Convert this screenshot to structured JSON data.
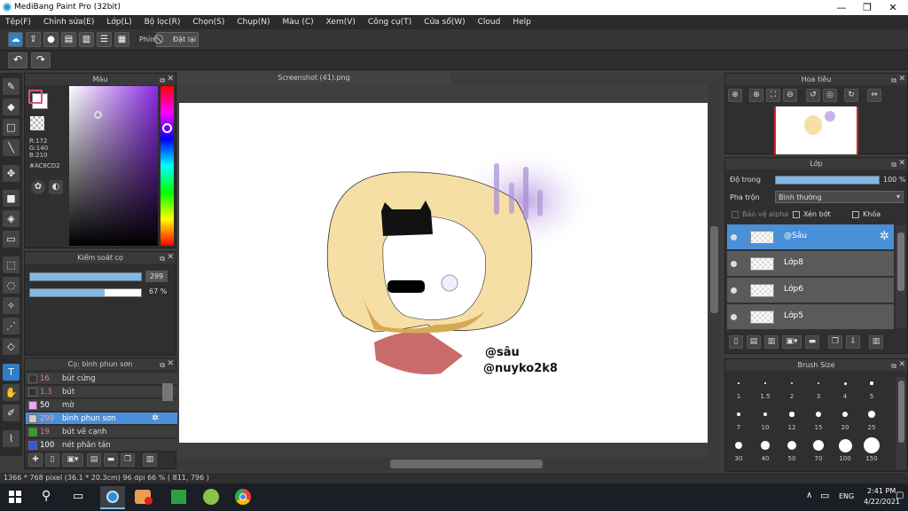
{
  "window": {
    "title": "MediBang Paint Pro (32bit)",
    "minimize": "—",
    "maximize": "❐",
    "close": "✕"
  },
  "menu": [
    "Tệp(F)",
    "Chỉnh sửa(E)",
    "Lớp(L)",
    "Bộ lọc(R)",
    "Chọn(S)",
    "Chụp(N)",
    "Màu (C)",
    "Xem(V)",
    "Công cụ(T)",
    "Cửa sổ(W)",
    "Cloud",
    "Help"
  ],
  "toolbar": {
    "key_label": "Phím",
    "reset_label": "Đặt lại"
  },
  "color_panel": {
    "title": "Màu",
    "r": "R:172",
    "g": "G:140",
    "b": "B:210",
    "hex": "#AC8CD2",
    "main_color": "#ac8cd2"
  },
  "control_panel": {
    "title": "Kiểm soát cọ",
    "size_value": "299",
    "size_fraction": 1.0,
    "opacity_value": "67 %",
    "opacity_fraction": 0.67
  },
  "brush_panel": {
    "title": "Cọ: bình phun sơn",
    "items": [
      {
        "size": "16",
        "name": "bút cứng",
        "swatch": "#333333",
        "size_color": "#e07b7b"
      },
      {
        "size": "1.3",
        "name": "bút",
        "swatch": "#333333",
        "size_color": "#e07b7b"
      },
      {
        "size": "50",
        "name": "mờ",
        "swatch": "#f2a3f5",
        "size_color": "#ffffff"
      },
      {
        "size": "299",
        "name": "bình phun sơn",
        "swatch": "#cccccc",
        "size_color": "#e07b7b",
        "selected": true
      },
      {
        "size": "19",
        "name": "bút vẽ cạnh",
        "swatch": "#22aa22",
        "size_color": "#e07b7b"
      },
      {
        "size": "100",
        "name": "nét phân tán",
        "swatch": "#3355ee",
        "size_color": "#ffffff"
      }
    ]
  },
  "document": {
    "tab_title": "Screenshot (41).png",
    "watermark_1": "@sâu",
    "watermark_2": "@nuyko2k8"
  },
  "navigator": {
    "title": "Hoa tiêu"
  },
  "layer_panel": {
    "title": "Lớp",
    "opacity_label": "Độ trong",
    "opacity_value": "100 %",
    "opacity_fraction": 1.0,
    "blend_label": "Pha trộn",
    "blend_value": "Bình thường",
    "protect_alpha": "Bảo vệ alpha",
    "clipping": "Xén bớt",
    "lock": "Khóa",
    "layers": [
      {
        "name": "@Sâu",
        "selected": true
      },
      {
        "name": "Lớp8"
      },
      {
        "name": "Lớp6"
      },
      {
        "name": "Lớp5"
      }
    ]
  },
  "brush_size_panel": {
    "title": "Brush Size",
    "sizes": [
      "1",
      "1.5",
      "2",
      "3",
      "4",
      "5",
      "7",
      "10",
      "12",
      "15",
      "20",
      "25",
      "30",
      "40",
      "50",
      "70",
      "100",
      "150"
    ]
  },
  "status": {
    "text": "1366 * 768 pixel   (36.1 * 20.3cm)   96 dpi   66 %   ( 811, 796 )"
  },
  "taskbar": {
    "lang": "ENG",
    "time": "2:41 PM",
    "date": "4/22/2021"
  }
}
